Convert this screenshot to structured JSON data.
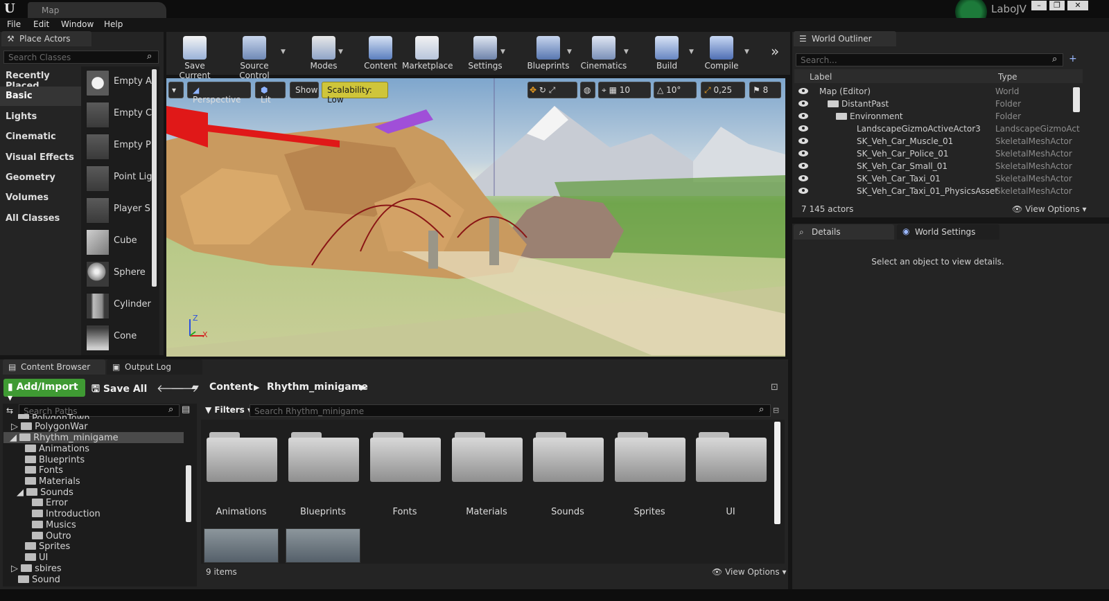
{
  "window": {
    "tab_title": "Map",
    "user": "LaboJV",
    "logo": "U"
  },
  "menu": [
    "File",
    "Edit",
    "Window",
    "Help"
  ],
  "place_actors": {
    "tab": "Place Actors",
    "search_placeholder": "Search Classes",
    "categories": [
      "Recently Placed",
      "Basic",
      "Lights",
      "Cinematic",
      "Visual Effects",
      "Geometry",
      "Volumes",
      "All Classes"
    ],
    "active_category": "Basic",
    "actors": [
      "Empty A",
      "Empty C",
      "Empty P",
      "Point Lig",
      "Player S",
      "Cube",
      "Sphere",
      "Cylinder",
      "Cone"
    ]
  },
  "toolbar": [
    "Save Current",
    "Source Control",
    "Modes",
    "Content",
    "Marketplace",
    "Settings",
    "Blueprints",
    "Cinematics",
    "Build",
    "Compile"
  ],
  "viewport": {
    "perspective": "Perspective",
    "lit": "Lit",
    "show": "Show",
    "scalability": "Scalability: Low",
    "grid_snap": "10",
    "rot_snap": "10°",
    "scale_snap": "0,25",
    "camera_speed": "8",
    "axis_z": "Z",
    "axis_x": "X"
  },
  "outliner": {
    "tab": "World Outliner",
    "search_placeholder": "Search...",
    "col_label": "Label",
    "col_type": "Type",
    "rows": [
      {
        "label": "Map (Editor)",
        "type": "World"
      },
      {
        "label": "DistantPast",
        "type": "Folder"
      },
      {
        "label": "Environment",
        "type": "Folder"
      },
      {
        "label": "LandscapeGizmoActiveActor3",
        "type": "LandscapeGizmoAct"
      },
      {
        "label": "SK_Veh_Car_Muscle_01",
        "type": "SkeletalMeshActor"
      },
      {
        "label": "SK_Veh_Car_Police_01",
        "type": "SkeletalMeshActor"
      },
      {
        "label": "SK_Veh_Car_Small_01",
        "type": "SkeletalMeshActor"
      },
      {
        "label": "SK_Veh_Car_Taxi_01",
        "type": "SkeletalMeshActor"
      },
      {
        "label": "SK_Veh_Car_Taxi_01_PhysicsAsset",
        "type": "SkeletalMeshActor"
      }
    ],
    "count": "7 145 actors",
    "view_options": "View Options"
  },
  "details": {
    "tab1": "Details",
    "tab2": "World Settings",
    "empty": "Select an object to view details."
  },
  "content_browser": {
    "tab1": "Content Browser",
    "tab2": "Output Log",
    "add_import": "Add/Import",
    "save_all": "Save All",
    "path": [
      "Content",
      "Rhythm_minigame"
    ],
    "search_paths": "Search Paths",
    "filters": "Filters",
    "search_assets": "Search Rhythm_minigame",
    "tree": [
      {
        "label": "PolygonTown",
        "level": 1
      },
      {
        "label": "PolygonWar",
        "level": 1
      },
      {
        "label": "Rhythm_minigame",
        "level": 1
      },
      {
        "label": "Animations",
        "level": 2
      },
      {
        "label": "Blueprints",
        "level": 2
      },
      {
        "label": "Fonts",
        "level": 2
      },
      {
        "label": "Materials",
        "level": 2
      },
      {
        "label": "Sounds",
        "level": 2
      },
      {
        "label": "Error",
        "level": 3
      },
      {
        "label": "Introduction",
        "level": 3
      },
      {
        "label": "Musics",
        "level": 3
      },
      {
        "label": "Outro",
        "level": 3
      },
      {
        "label": "Sprites",
        "level": 2
      },
      {
        "label": "UI",
        "level": 2
      },
      {
        "label": "sbires",
        "level": 1
      },
      {
        "label": "Sound",
        "level": 1
      }
    ],
    "folders": [
      "Animations",
      "Blueprints",
      "Fonts",
      "Materials",
      "Sounds",
      "Sprites",
      "UI"
    ],
    "item_count": "9 items",
    "view_options": "View Options"
  }
}
